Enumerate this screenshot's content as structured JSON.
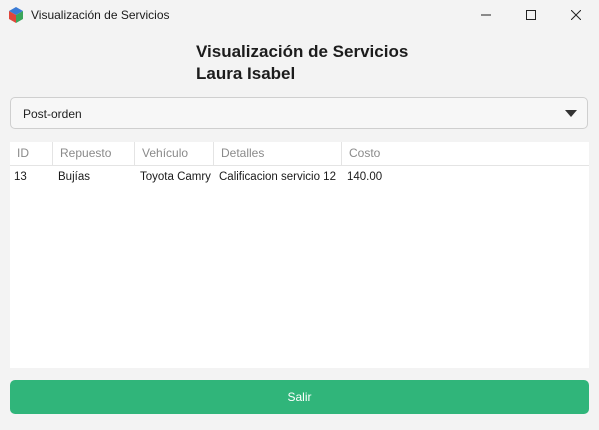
{
  "window": {
    "title": "Visualización de Servicios"
  },
  "heading": {
    "title": "Visualización de Servicios",
    "name": "Laura Isabel"
  },
  "combo": {
    "selected": "Post-orden"
  },
  "table": {
    "columns": [
      "ID",
      "Repuesto",
      "Vehículo",
      "Detalles",
      "Costo"
    ],
    "rows": [
      [
        "13",
        "Bujías",
        "Toyota Camry",
        "Calificacion servicio 12",
        "140.00"
      ]
    ]
  },
  "actions": {
    "exit_label": "Salir"
  },
  "colors": {
    "exit_button": "#30b57a"
  }
}
